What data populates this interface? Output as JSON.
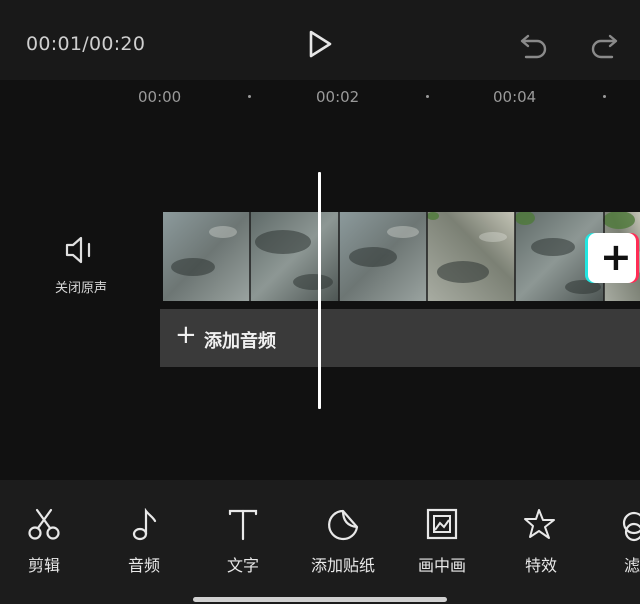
{
  "top_bar": {
    "time": "00:01/00:20",
    "icons": [
      "play-icon",
      "undo-icon",
      "redo-icon"
    ]
  },
  "ruler": {
    "ticks": [
      "00:00",
      "00:02",
      "00:04"
    ]
  },
  "track": {
    "mute_label": "关闭原声",
    "add_audio_label": "添加音频",
    "add_clip_icon": "+"
  },
  "toolbar": {
    "items": [
      {
        "label": "剪辑",
        "icon": "scissors-icon"
      },
      {
        "label": "音频",
        "icon": "music-note-icon"
      },
      {
        "label": "文字",
        "icon": "text-icon"
      },
      {
        "label": "添加贴纸",
        "icon": "sticker-icon"
      },
      {
        "label": "画中画",
        "icon": "picture-in-picture-icon"
      },
      {
        "label": "特效",
        "icon": "effects-star-icon"
      },
      {
        "label": "滤",
        "icon": "filter-icon"
      }
    ]
  },
  "colors": {
    "background": "#111111",
    "top_bar": "#191919",
    "audio_track": "#3a3a3a",
    "accent_cyan": "#23e6e1",
    "accent_red": "#ff2d55"
  }
}
